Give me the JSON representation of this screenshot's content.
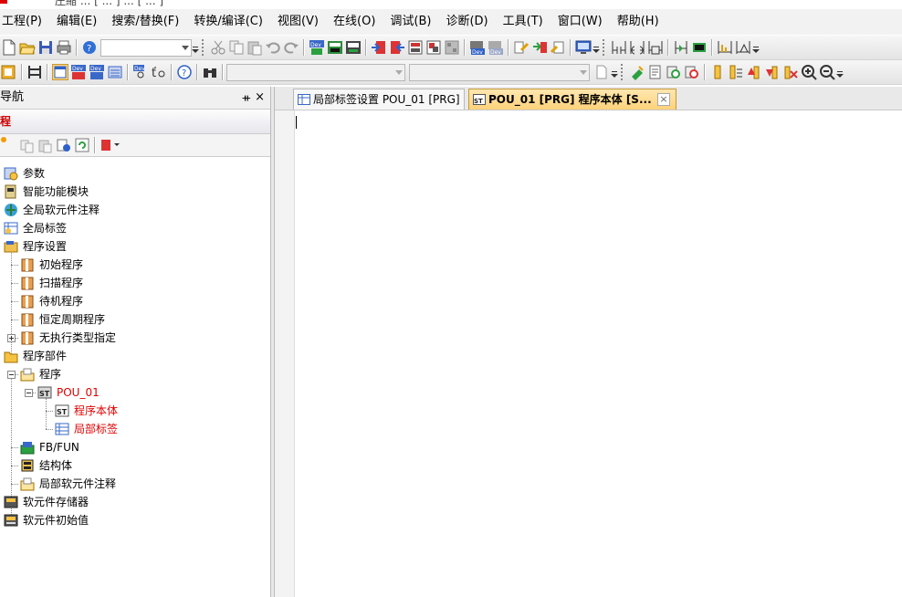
{
  "window": {
    "partial_title": "圧縮 ... [ ... ] ... [ ... ]"
  },
  "menu": [
    {
      "label": "工程(P)"
    },
    {
      "label": "编辑(E)"
    },
    {
      "label": "搜索/替换(F)"
    },
    {
      "label": "转换/编译(C)"
    },
    {
      "label": "视图(V)"
    },
    {
      "label": "在线(O)"
    },
    {
      "label": "调试(B)"
    },
    {
      "label": "诊断(D)"
    },
    {
      "label": "工具(T)"
    },
    {
      "label": "窗口(W)"
    },
    {
      "label": "帮助(H)"
    }
  ],
  "toolbar1": {
    "combo_value": "",
    "icons": [
      "new-file-icon",
      "open-folder-icon",
      "save-icon",
      "print-icon",
      "help-icon"
    ],
    "edit_icons": [
      "cut-icon",
      "copy-icon",
      "paste-icon",
      "undo-icon",
      "redo-icon"
    ],
    "device_icons": [
      "device-read-icon",
      "device-write-icon",
      "device-verify-icon",
      "plc-read-icon",
      "plc-write-icon",
      "plc-verify-icon",
      "plc-remote-icon",
      "plc-delete-icon",
      "device-test-icon",
      "device-batch-icon",
      "write-to-plc-icon",
      "read-from-plc-icon",
      "verify-plc-icon",
      "monitor-icon"
    ],
    "ladder_icons": [
      "ladder-contact-icon",
      "ladder-coil-icon",
      "ladder-function-icon",
      "ladder-insert-icon",
      "ladder-delete-icon",
      "ladder-rise-icon",
      "ladder-fall-icon"
    ]
  },
  "toolbar2": {
    "combo1_value": "",
    "combo2_value": "",
    "st_icons": [
      "compile-icon",
      "edit-list-icon",
      "find-device-icon",
      "find-instruction-icon",
      "bookmark-icon",
      "bookmark-list-icon",
      "bookmark-next-icon",
      "bookmark-prev-icon",
      "bookmark-clear-icon",
      "zoom-in-icon",
      "zoom-out-icon"
    ]
  },
  "navigation": {
    "title": "导航",
    "pin": "ᚑ",
    "close": "×",
    "project_header": "程",
    "tree": [
      {
        "label": "参数",
        "level": 0,
        "icon": "parameter-icon",
        "red": false
      },
      {
        "label": "智能功能模块",
        "level": 0,
        "icon": "intelligent-module-icon",
        "red": false
      },
      {
        "label": "全局软元件注释",
        "level": 0,
        "icon": "global-comment-icon",
        "red": false
      },
      {
        "label": "全局标签",
        "level": 0,
        "icon": "global-label-icon",
        "red": false
      },
      {
        "label": "程序设置",
        "level": 0,
        "icon": "program-setting-icon",
        "red": false
      },
      {
        "label": "初始程序",
        "level": 1,
        "icon": "program-folder-icon",
        "red": false
      },
      {
        "label": "扫描程序",
        "level": 1,
        "icon": "program-folder-icon",
        "red": false
      },
      {
        "label": "待机程序",
        "level": 1,
        "icon": "program-folder-icon",
        "red": false
      },
      {
        "label": "恒定周期程序",
        "level": 1,
        "icon": "program-folder-icon",
        "red": false
      },
      {
        "label": "无执行类型指定",
        "level": 1,
        "icon": "program-folder-icon",
        "red": false
      },
      {
        "label": "程序部件",
        "level": 0,
        "icon": "program-parts-icon",
        "red": false
      },
      {
        "label": "程序",
        "level": 1,
        "icon": "folder-icon",
        "red": false
      },
      {
        "label": "POU_01",
        "level": 2,
        "icon": "st-pou-icon",
        "red": true
      },
      {
        "label": "程序本体",
        "level": 3,
        "icon": "st-body-icon",
        "red": true
      },
      {
        "label": "局部标签",
        "level": 3,
        "icon": "local-label-icon",
        "red": true
      },
      {
        "label": "FB/FUN",
        "level": 1,
        "icon": "fb-fun-icon",
        "red": false
      },
      {
        "label": "结构体",
        "level": 1,
        "icon": "structure-icon",
        "red": false
      },
      {
        "label": "局部软元件注释",
        "level": 1,
        "icon": "local-comment-icon",
        "red": false
      },
      {
        "label": "软元件存储器",
        "level": 0,
        "icon": "device-memory-icon",
        "red": false
      },
      {
        "label": "软元件初始值",
        "level": 0,
        "icon": "device-init-icon",
        "red": false
      }
    ]
  },
  "tabs": [
    {
      "label": "局部标签设置 POU_01 [PRG]",
      "active": false
    },
    {
      "label": "POU_01 [PRG] 程序本体 [S...",
      "active": true
    }
  ],
  "tab_close": "×",
  "colors": {
    "active_tab": "#ffd27a",
    "tree_red": "#e00000",
    "nav_header_red": "#cc0000"
  }
}
